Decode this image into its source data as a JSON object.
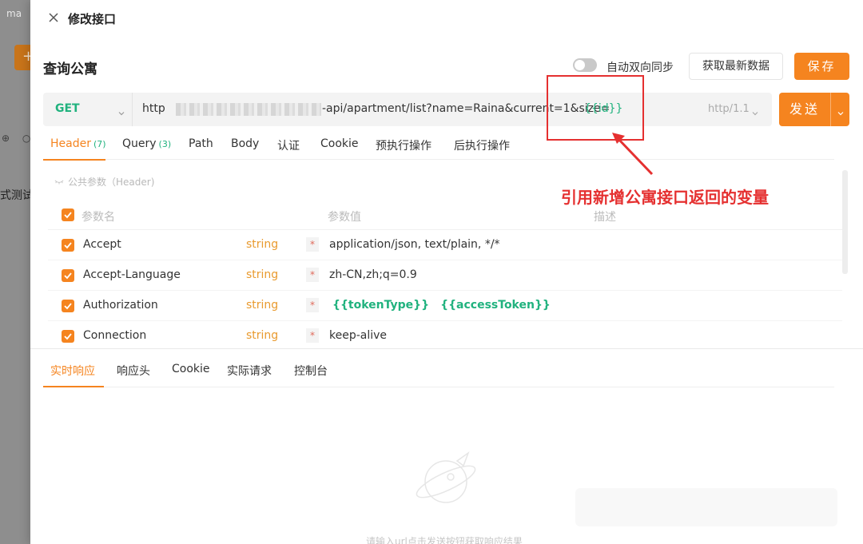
{
  "background_app": {
    "tab_text": "ma",
    "plus_label": "+",
    "icons_text": "⊕ ○",
    "side_text": "式测试"
  },
  "drawer": {
    "title": "修改接口",
    "api_name": "查询公寓",
    "sync_label": "自动双向同步",
    "sync_enabled": false,
    "fetch_label": "获取最新数据",
    "save_label": "保存"
  },
  "request": {
    "method": "GET",
    "url_prefix": "http",
    "url_path": "-api/apartment/list?name=Raina&current=1&size=",
    "url_variable": "{{id}}",
    "protocol": "http/1.1",
    "send_label": "发送"
  },
  "request_tabs": [
    {
      "label": "Header",
      "count": "(7)"
    },
    {
      "label": "Query",
      "count": "(3)"
    },
    {
      "label": "Path",
      "count": ""
    },
    {
      "label": "Body",
      "count": ""
    },
    {
      "label": "认证",
      "count": ""
    },
    {
      "label": "Cookie",
      "count": ""
    },
    {
      "label": "预执行操作",
      "count": ""
    },
    {
      "label": "后执行操作",
      "count": ""
    }
  ],
  "headers_section": {
    "label": "公共参数（Header)",
    "columns": {
      "name": "参数名",
      "value": "参数值",
      "desc": "描述"
    },
    "rows": [
      {
        "name": "Accept",
        "type": "string",
        "required": "*",
        "value": "application/json, text/plain, */*"
      },
      {
        "name": "Accept-Language",
        "type": "string",
        "required": "*",
        "value": "zh-CN,zh;q=0.9"
      },
      {
        "name": "Authorization",
        "type": "string",
        "required": "*",
        "value_vars": [
          "{{tokenType}}",
          "{{accessToken}}"
        ]
      },
      {
        "name": "Connection",
        "type": "string",
        "required": "*",
        "value": "keep-alive"
      }
    ]
  },
  "response_tabs": [
    "实时响应",
    "响应头",
    "Cookie",
    "实际请求",
    "控制台"
  ],
  "response_empty_hint": "请输入url点击发送按钮获取响应结果",
  "annotation": {
    "text": "引用新增公寓接口返回的变量",
    "color": "#e53030"
  },
  "colors": {
    "accent": "#f5841f",
    "variable": "#20b27e",
    "type": "#e99a2e"
  }
}
